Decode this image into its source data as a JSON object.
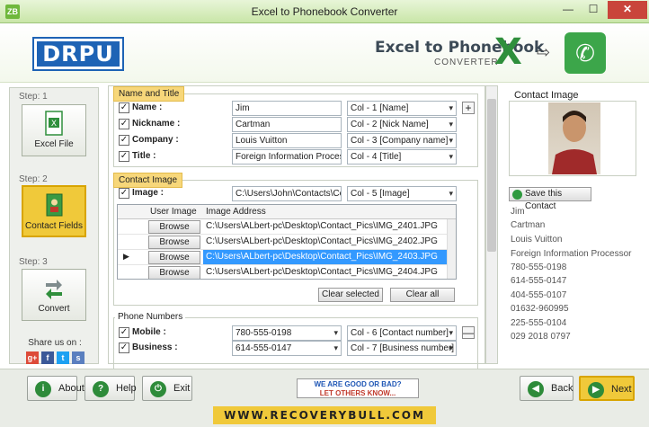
{
  "window": {
    "title": "Excel to Phonebook Converter",
    "app_icon_text": "ZB",
    "min": "—",
    "max": "☐",
    "close": "✕"
  },
  "header": {
    "logo": "DRPU",
    "title": "Excel to Phonebook",
    "subtitle": "CONVERTER"
  },
  "steps": [
    {
      "step": "Step: 1",
      "label": "Excel File"
    },
    {
      "step": "Step: 2",
      "label": "Contact Fields"
    },
    {
      "step": "Step: 3",
      "label": "Convert"
    }
  ],
  "share": {
    "label": "Share us on :"
  },
  "name_title": {
    "group": "Name and Title",
    "rows": [
      {
        "label": "Name :",
        "value": "Jim",
        "column": "Col - 1 [Name]"
      },
      {
        "label": "Nickname :",
        "value": "Cartman",
        "column": "Col - 2 [Nick Name]"
      },
      {
        "label": "Company :",
        "value": "Louis Vuitton",
        "column": "Col - 3 [Company name]"
      },
      {
        "label": "Title :",
        "value": "Foreign Information Processor",
        "column": "Col - 4 [Title]"
      }
    ],
    "add": "+"
  },
  "contact_image": {
    "group": "Contact Image",
    "label": "Image :",
    "path": "C:\\Users\\John\\Contacts\\Co",
    "column": "Col - 5 [Image]",
    "grid_headers": [
      "User Image",
      "Image Address"
    ],
    "browse": "Browse",
    "rows": [
      "C:\\Users\\ALbert-pc\\Desktop\\Contact_Pics\\IMG_2401.JPG",
      "C:\\Users\\ALbert-pc\\Desktop\\Contact_Pics\\IMG_2402.JPG",
      "C:\\Users\\ALbert-pc\\Desktop\\Contact_Pics\\IMG_2403.JPG",
      "C:\\Users\\ALbert-pc\\Desktop\\Contact_Pics\\IMG_2404.JPG"
    ],
    "clear_selected": "Clear selected",
    "clear_all": "Clear all"
  },
  "phones": {
    "group": "Phone Numbers",
    "rows": [
      {
        "label": "Mobile :",
        "value": "780-555-0198",
        "column": "Col - 6 [Contact number]"
      },
      {
        "label": "Business :",
        "value": "614-555-0147",
        "column": "Col - 7 [Business number]"
      }
    ],
    "remove": "—"
  },
  "contact": {
    "title": "Contact Image",
    "save": "Save this Contact",
    "lines": [
      "Jim",
      "Cartman",
      "Louis Vuitton",
      "Foreign Information Processor",
      "780-555-0198",
      "614-555-0147",
      "404-555-0107",
      "01632-960995",
      "225-555-0104",
      "029 2018 0797"
    ]
  },
  "footer": {
    "about": "About",
    "help": "Help",
    "exit": "Exit",
    "banner_1": "WE ARE GOOD OR BAD?",
    "banner_2": "LET OTHERS KNOW...",
    "back": "Back",
    "next": "Next",
    "site": "WWW.RECOVERYBULL.COM"
  },
  "colors": {
    "accent": "#f0c93a",
    "green": "#2e8b3a",
    "selection": "#3399ff"
  }
}
